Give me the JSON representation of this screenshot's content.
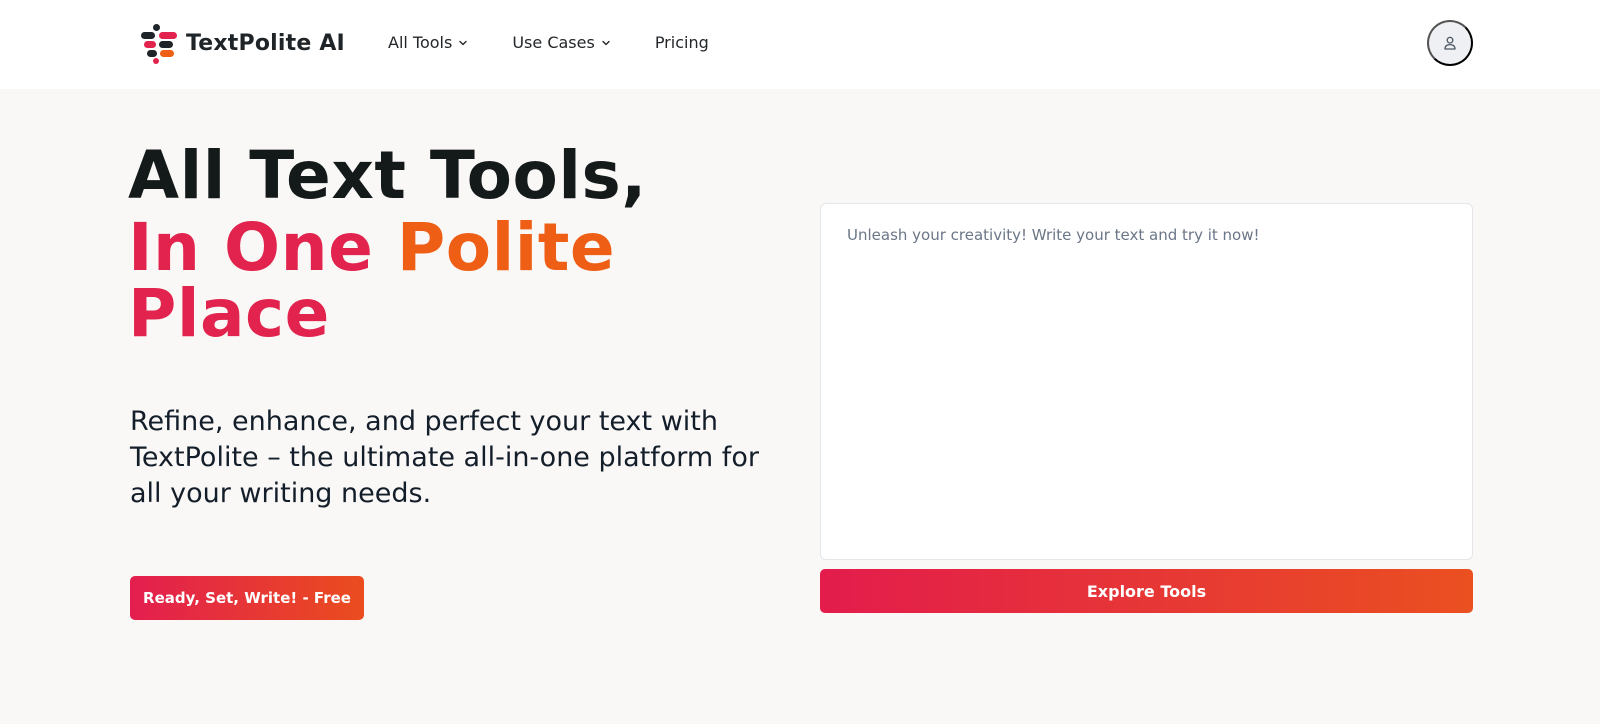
{
  "brand": {
    "name": "TextPolite AI",
    "logo_icon": "textpolite-logo-icon",
    "colors": {
      "primary_red": "#e1234d",
      "primary_orange": "#ee5f15",
      "dark": "#141a1a"
    }
  },
  "nav": {
    "items": [
      {
        "label": "All Tools",
        "has_dropdown": true
      },
      {
        "label": "Use Cases",
        "has_dropdown": true
      },
      {
        "label": "Pricing",
        "has_dropdown": false
      }
    ],
    "user_icon": "user-icon"
  },
  "hero": {
    "title_line1": "All Text Tools,",
    "title_line2_part1": "In One",
    "title_line2_part2": "Polite",
    "title_line3": "Place",
    "description": "Refine, enhance, and perfect your text with TextPolite – the ultimate all-in-one platform for all your writing needs.",
    "cta_label": "Ready, Set, Write! - Free"
  },
  "editor": {
    "placeholder": "Unleash your creativity! Write your text and try it now!",
    "value": "",
    "button_label": "Explore Tools"
  }
}
